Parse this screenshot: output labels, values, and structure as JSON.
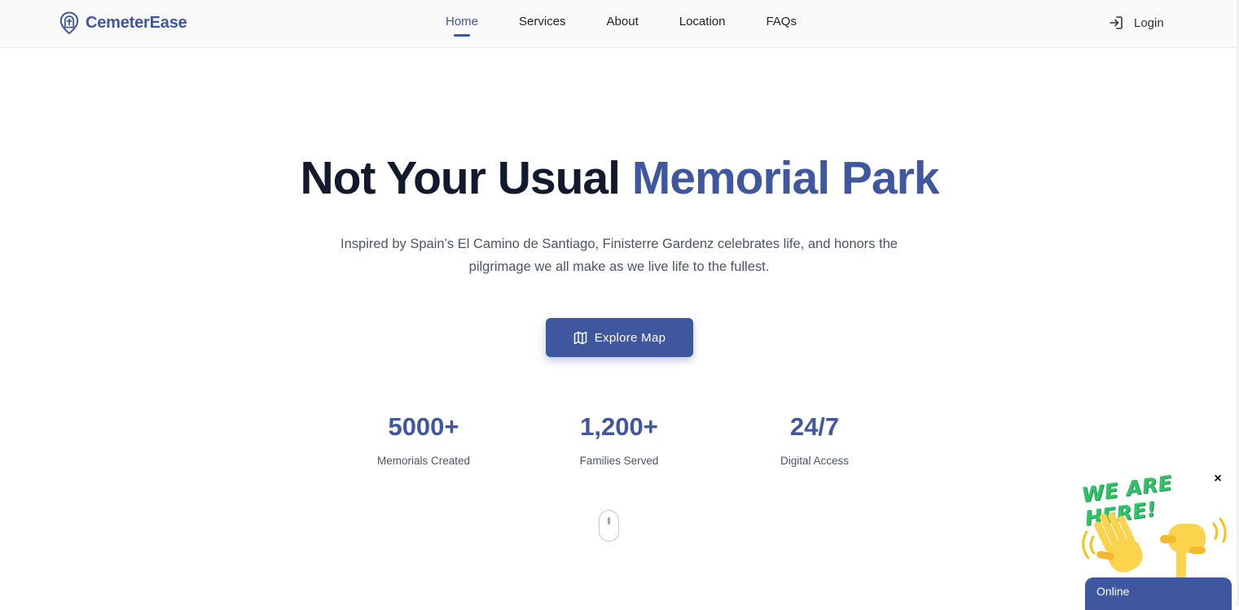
{
  "brand": {
    "name": "CemeterEase",
    "icon": "location-pin-cross-icon"
  },
  "nav": {
    "items": [
      {
        "label": "Home",
        "active": true
      },
      {
        "label": "Services",
        "active": false
      },
      {
        "label": "About",
        "active": false
      },
      {
        "label": "Location",
        "active": false
      },
      {
        "label": "FAQs",
        "active": false
      }
    ],
    "login_label": "Login",
    "login_icon": "login-arrow-icon"
  },
  "hero": {
    "title_part1": "Not Your Usual",
    "title_part2": "Memorial Park",
    "subtitle": "Inspired by Spain’s El Camino de Santiago, Finisterre Gardenz celebrates life, and honors the pilgrimage we all make as we live life to the fullest.",
    "cta_label": "Explore Map",
    "cta_icon": "map-icon"
  },
  "stats": [
    {
      "value": "5000+",
      "label": "Memorials Created"
    },
    {
      "value": "1,200+",
      "label": "Families Served"
    },
    {
      "value": "24/7",
      "label": "Digital Access"
    }
  ],
  "chat": {
    "banner": "WE ARE HERE!",
    "close": "×",
    "status": "Online"
  },
  "colors": {
    "accent": "#3f579e",
    "title_dark": "#141a2e",
    "chat_green": "#32c26a"
  }
}
